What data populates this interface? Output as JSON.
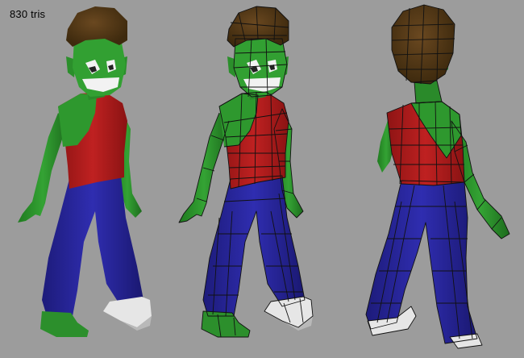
{
  "viewport": {
    "triangle_count_label": "830 tris",
    "background_color": "#9c9c9c"
  },
  "models": [
    {
      "view": "front-three-quarter",
      "render_mode": "shaded"
    },
    {
      "view": "front-three-quarter",
      "render_mode": "shaded-wireframe"
    },
    {
      "view": "back-three-quarter",
      "render_mode": "shaded-wireframe"
    }
  ],
  "palette": {
    "skin": "#2f9b2f",
    "skin_shadow": "#1f6e1f",
    "hair": "#5a3d17",
    "shirt_red": "#b31e1e",
    "pants_blue": "#2c2aa3",
    "shoe_white": "#e8e8e8",
    "teeth": "#f2f2f2"
  }
}
